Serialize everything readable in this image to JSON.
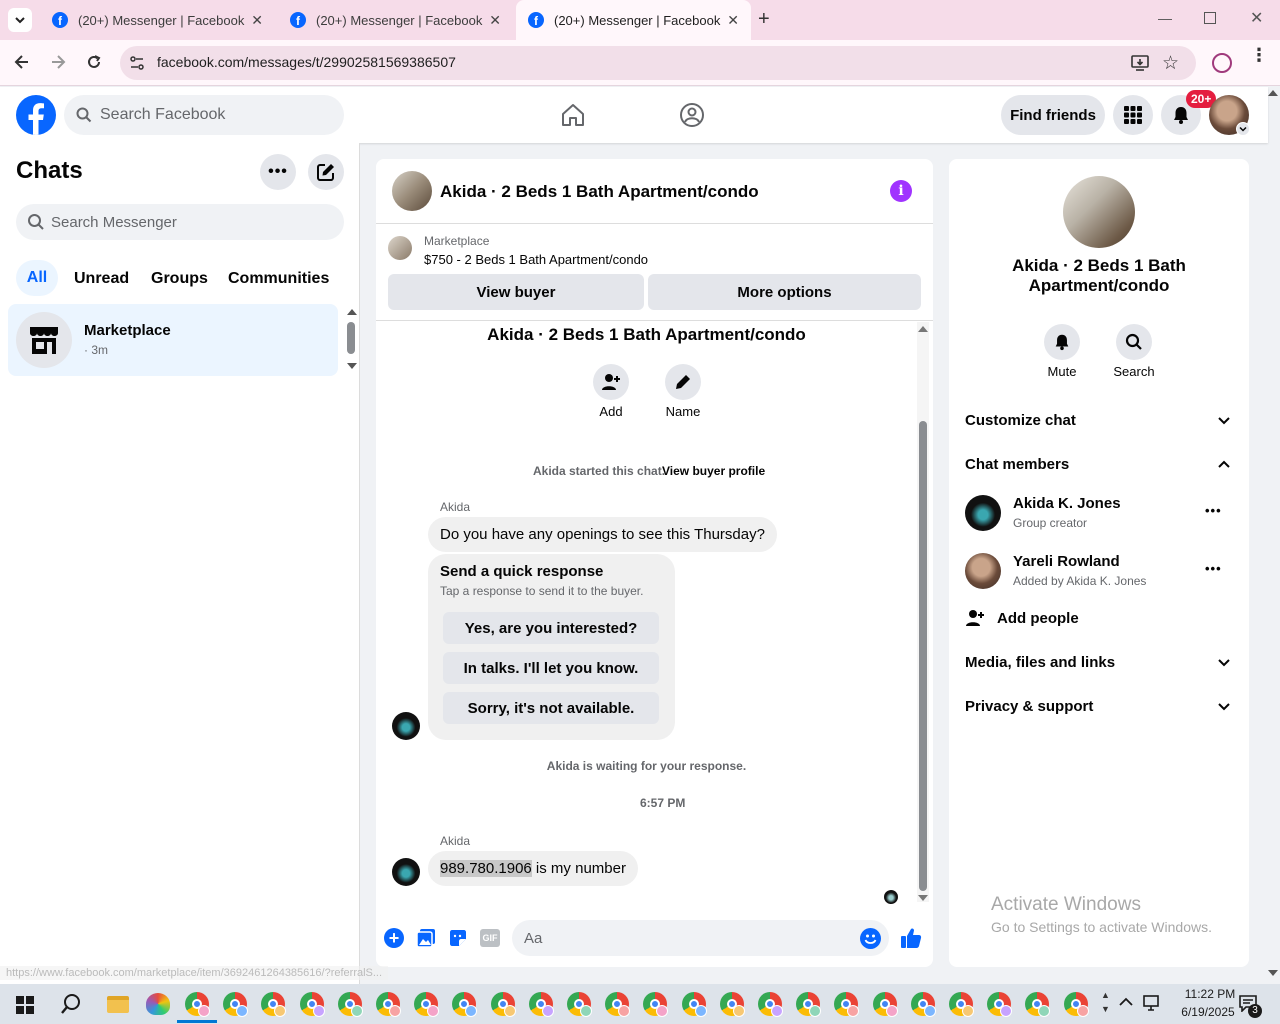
{
  "browser": {
    "tabs": [
      {
        "title": "(20+) Messenger | Facebook"
      },
      {
        "title": "(20+) Messenger | Facebook"
      },
      {
        "title": "(20+) Messenger | Facebook"
      }
    ],
    "url": "facebook.com/messages/t/29902581569386507"
  },
  "header": {
    "search_placeholder": "Search Facebook",
    "find_friends": "Find friends",
    "notif_badge": "20+"
  },
  "left": {
    "title": "Chats",
    "search_placeholder": "Search Messenger",
    "filters": [
      "All",
      "Unread",
      "Groups",
      "Communities"
    ],
    "chat": {
      "name": "Marketplace",
      "time": "· 3m"
    }
  },
  "chat": {
    "title": "Akida · 2 Beds 1 Bath Apartment/condo",
    "listing_source": "Marketplace",
    "listing_text": "$750 - 2 Beds 1 Bath Apartment/condo",
    "view_buyer": "View buyer",
    "more_options": "More options",
    "group_title": "Akida · 2 Beds 1 Bath Apartment/condo",
    "add_label": "Add",
    "name_label": "Name",
    "started_text": "Akida started this chat.",
    "view_profile": "View buyer profile",
    "sender1": "Akida",
    "message1": "Do you have any openings to see this Thursday?",
    "qr_title": "Send a quick response",
    "qr_sub": "Tap a response to send it to the buyer.",
    "qr_options": [
      "Yes, are you interested?",
      "In talks. I'll let you know.",
      "Sorry, it's not available."
    ],
    "waiting": "Akida is waiting for your response.",
    "time": "6:57 PM",
    "sender2": "Akida",
    "phone": "989.780.1906",
    "message2_rest": " is my number",
    "composer_placeholder": "Aa",
    "status_url": "https://www.facebook.com/marketplace/item/3692461264385616/?referralS..."
  },
  "right": {
    "title": "Akida · 2 Beds 1 Bath Apartment/condo",
    "mute": "Mute",
    "search": "Search",
    "customize": "Customize chat",
    "members_heading": "Chat members",
    "members": [
      {
        "name": "Akida K. Jones",
        "sub": "Group creator"
      },
      {
        "name": "Yareli Rowland",
        "sub": "Added by Akida K. Jones"
      }
    ],
    "add_people": "Add people",
    "media": "Media, files and links",
    "privacy": "Privacy & support",
    "watermark_title": "Activate Windows",
    "watermark_sub": "Go to Settings to activate Windows."
  },
  "taskbar": {
    "time": "11:22 PM",
    "date": "6/19/2025",
    "notif_count": "3"
  },
  "colors": {
    "fb_blue": "#0866ff",
    "messenger_purple": "#a033ff",
    "badge_red": "#e41e3f"
  }
}
